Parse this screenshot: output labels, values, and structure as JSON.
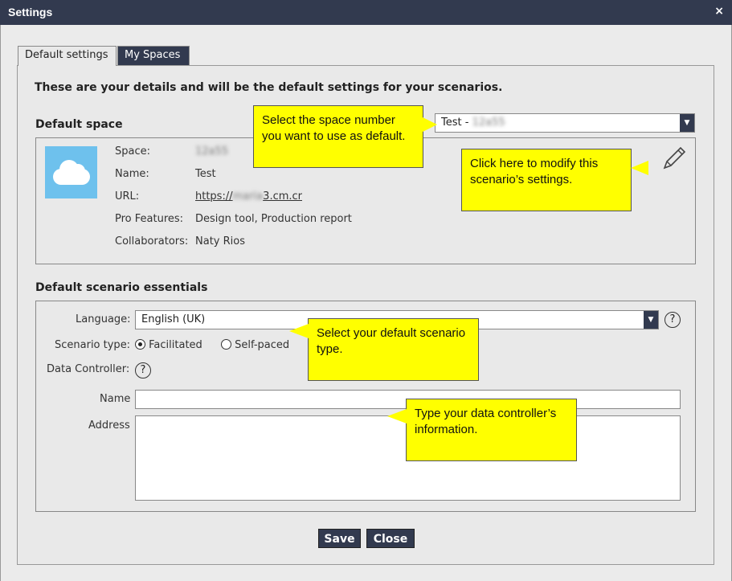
{
  "window": {
    "title": "Settings",
    "close_glyph": "×"
  },
  "tabs": [
    {
      "label": "Default settings",
      "active": true
    },
    {
      "label": "My Spaces",
      "active": false
    }
  ],
  "intro": "These are your details and will be the default settings for your scenarios.",
  "default_space": {
    "heading": "Default space",
    "selected": "Test - ",
    "selected_hidden": "12a55",
    "icon": "cloud-icon",
    "fields": {
      "space_label": "Space:",
      "space_value": "12a55",
      "name_label": "Name:",
      "name_value": "Test",
      "url_label": "URL:",
      "url_prefix": "https://",
      "url_hidden": "maria",
      "url_suffix": "3.cm.cr",
      "pro_label": "Pro Features:",
      "pro_value": "Design tool, Production report",
      "collab_label": "Collaborators:",
      "collab_value": "Naty Rios"
    }
  },
  "essentials": {
    "heading": "Default scenario essentials",
    "language_label": "Language:",
    "language_value": "English (UK)",
    "scenario_label": "Scenario type:",
    "option_facilitated": "Facilitated",
    "option_selfpaced": "Self-paced",
    "selected_scenario": "Facilitated",
    "controller_label": "Data Controller:",
    "name_label": "Name",
    "address_label": "Address",
    "name_value": "",
    "address_value": ""
  },
  "buttons": {
    "save": "Save",
    "close": "Close"
  },
  "callouts": {
    "space": "Select the space number you want to use as default.",
    "modify": "Click here to modify this scenario’s settings.",
    "scenario": "Select your default scenario type.",
    "controller": "Type your data controller’s information."
  },
  "colors": {
    "accent": "#323a4f",
    "callout": "#ffff00",
    "cloud": "#6ec1ed"
  }
}
